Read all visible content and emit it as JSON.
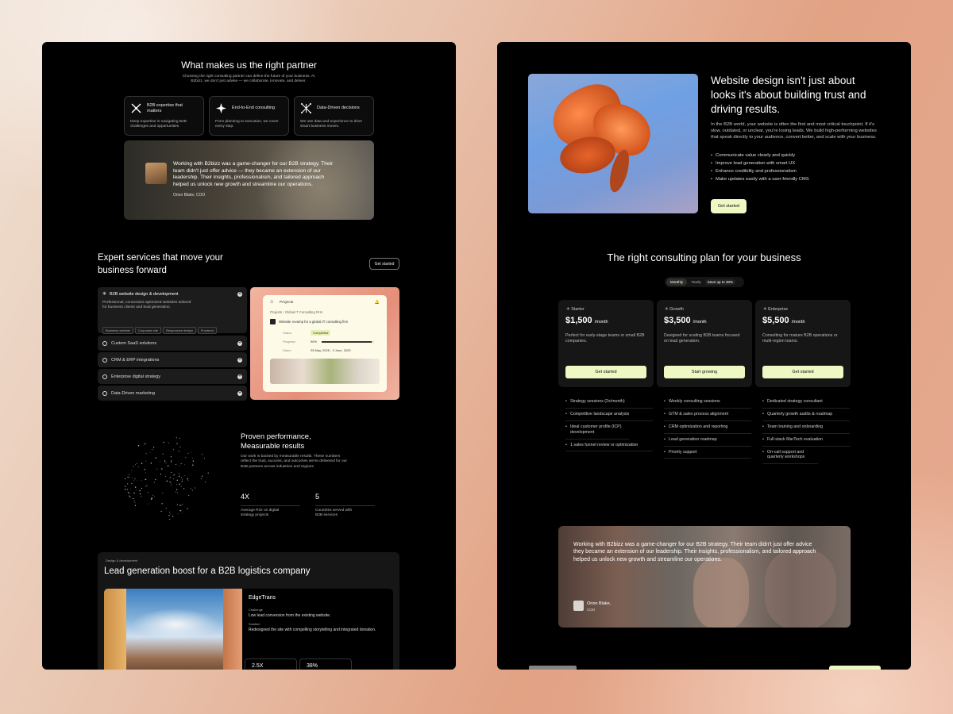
{
  "left": {
    "partner": {
      "heading": "What makes us the right partner",
      "intro": "Choosing the right consulting partner can define the future of your business. At B2bizz, we don't just advise — we collaborate, innovate, and deliver.",
      "features": [
        {
          "icon": "pinwheel-icon",
          "title": "B2B expertise that matters",
          "desc": "Deep expertise in navigating B2B challenges and opportunities."
        },
        {
          "icon": "star-burst-icon",
          "title": "End-to-End consulting",
          "desc": "From planning to execution, we cover every step."
        },
        {
          "icon": "network-icon",
          "title": "Data-Driven decisions",
          "desc": "We use data and experience to drive smart business moves."
        }
      ],
      "testimonial": {
        "quote": "Working with B2bizz was a game-changer for our B2B strategy. Their team didn't just offer advice — they became an extension of our leadership. Their insights, professionalism, and tailored approach helped us unlock new growth and streamline our operations.",
        "author": "Orion Blake,  COO"
      }
    },
    "services": {
      "heading": "Expert services that move your business forward",
      "cta": "Get started",
      "expanded": {
        "title": "B2B website design & development",
        "desc": "Professional, conversion-optimized websites tailored for business clients and lead generation.",
        "chips": [
          "Business website",
          "Corporate site",
          "Responsive design",
          "Frontend"
        ]
      },
      "items": [
        "Custom SaaS solutions",
        "CRM & ERP integrations",
        "Enterprise digital strategy",
        "Data-Driven marketing"
      ],
      "preview": {
        "header": "Projects",
        "breadcrumb": "Projects  ›  Global IT Consulting Firm",
        "title": "Website revamp for a global IT consulting firm",
        "status_label": "Status",
        "status_value": "Completed",
        "progress_label": "Progress",
        "progress_value": "96%",
        "progress": 0.96,
        "dates_label": "Dates",
        "dates_value": "25 May, 2025 - 3 June, 2025"
      }
    },
    "performance": {
      "heading": "Proven performance, Measurable results",
      "desc": "Our work is backed by measurable results. These numbers reflect the trust, success, and outcomes we've delivered for our B2B partners across industries and regions.",
      "stats": [
        {
          "value": "4X",
          "label": "Average ROI on digital strategy projects"
        },
        {
          "value": "5",
          "label": "Countries served with B2B services"
        }
      ]
    },
    "case_study": {
      "tag": "Design & development",
      "heading": "Lead generation boost for a B2B logistics company",
      "company": "EdgeTrans",
      "challenge_label": "Challenge",
      "challenge": "Low lead conversion from the existing website.",
      "solution_label": "Solution",
      "solution": "Redesigned the site with compelling storytelling and integrated donation.",
      "metrics": [
        "2.5X",
        "38%"
      ]
    }
  },
  "right": {
    "hero": {
      "heading": "Website design isn't just about looks it's about building trust and driving results.",
      "body": "In the B2B world, your website is often the first and most critical touchpoint. If it's slow, outdated, or unclear, you're losing leads. We build high-performing websites that speak directly to your audience, convert better, and scale with your business.",
      "bullets": [
        "Communicate value clearly and quickly",
        "Improve lead generation with smart UX",
        "Enhance credibility and professionalism",
        "Make updates easily with a user-friendly CMS"
      ],
      "cta": "Get started"
    },
    "pricing": {
      "heading": "The right consulting plan for your business",
      "toggle": [
        "Monthly",
        "Yearly"
      ],
      "save_badge": "Save up to 30%",
      "plans": [
        {
          "name": "Starter",
          "price": "$1,500",
          "period": "/month",
          "desc": "Perfect for early-stage teams or small B2B companies.",
          "cta": "Get started",
          "features": [
            "Strategy sessions (2x/month)",
            "Competitive landscape analysis",
            "Ideal customer profile (ICP) development",
            "1 sales funnel review or optimization"
          ]
        },
        {
          "name": "Growth",
          "price": "$3,500",
          "period": "/month",
          "desc": "Designed for scaling B2B teams focused on lead generation.",
          "cta": "Start growing",
          "features": [
            "Weekly consulting sessions",
            "GTM & sales process alignment",
            "CRM optimization and reporting",
            "Lead generation roadmap",
            "Priority support"
          ]
        },
        {
          "name": "Enterprise",
          "price": "$5,500",
          "period": "/month",
          "desc": "Consulting for mature B2B operations or multi-region teams.",
          "cta": "Get started",
          "features": [
            "Dedicated strategy consultant",
            "Quarterly growth audits & roadmap",
            "Team training and onboarding",
            "Full-stack MarTech evaluation",
            "On-call support and quarterly workshops"
          ]
        }
      ]
    },
    "testimonial": {
      "quote": "Working with B2bizz was a game-changer for our B2B strategy. Their team didn't just offer advice they became an extension of our leadership. Their insights, professionalism, and tailored approach helped us unlock new growth and streamline our operations.",
      "author": "Orion Blake,",
      "role": "COO"
    }
  },
  "colors": {
    "accent": "#eef8c2",
    "panel": "#000000"
  }
}
